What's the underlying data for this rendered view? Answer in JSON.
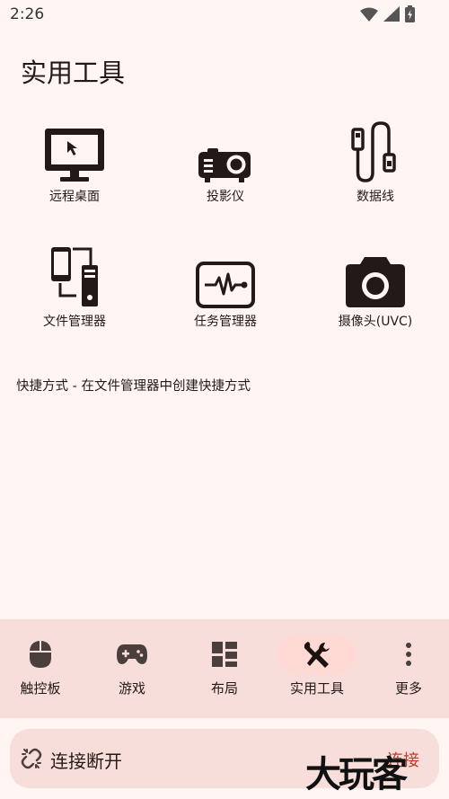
{
  "status_bar": {
    "time": "2:26"
  },
  "page": {
    "title": "实用工具"
  },
  "tools": [
    {
      "label": "远程桌面",
      "icon": "monitor-cursor-icon"
    },
    {
      "label": "投影仪",
      "icon": "projector-icon"
    },
    {
      "label": "数据线",
      "icon": "usb-cable-icon"
    },
    {
      "label": "文件管理器",
      "icon": "phone-pc-transfer-icon"
    },
    {
      "label": "任务管理器",
      "icon": "activity-monitor-icon"
    },
    {
      "label": "摄像头(UVC)",
      "icon": "camera-icon"
    }
  ],
  "hint": "快捷方式 - 在文件管理器中创建快捷方式",
  "bottom_nav": {
    "items": [
      {
        "label": "触控板",
        "icon": "mouse-icon",
        "active": false
      },
      {
        "label": "游戏",
        "icon": "gamepad-icon",
        "active": false
      },
      {
        "label": "布局",
        "icon": "layout-icon",
        "active": false
      },
      {
        "label": "实用工具",
        "icon": "tools-icon",
        "active": true
      },
      {
        "label": "更多",
        "icon": "more-vert-icon",
        "active": false
      }
    ]
  },
  "connection": {
    "status": "连接断开",
    "action": "连接",
    "icon": "link-off-icon"
  },
  "watermark": "大玩客",
  "colors": {
    "background": "#fff6f3",
    "nav_bg": "#f7dedb",
    "active_pill": "#ffdad4",
    "accent": "#c0392b"
  }
}
